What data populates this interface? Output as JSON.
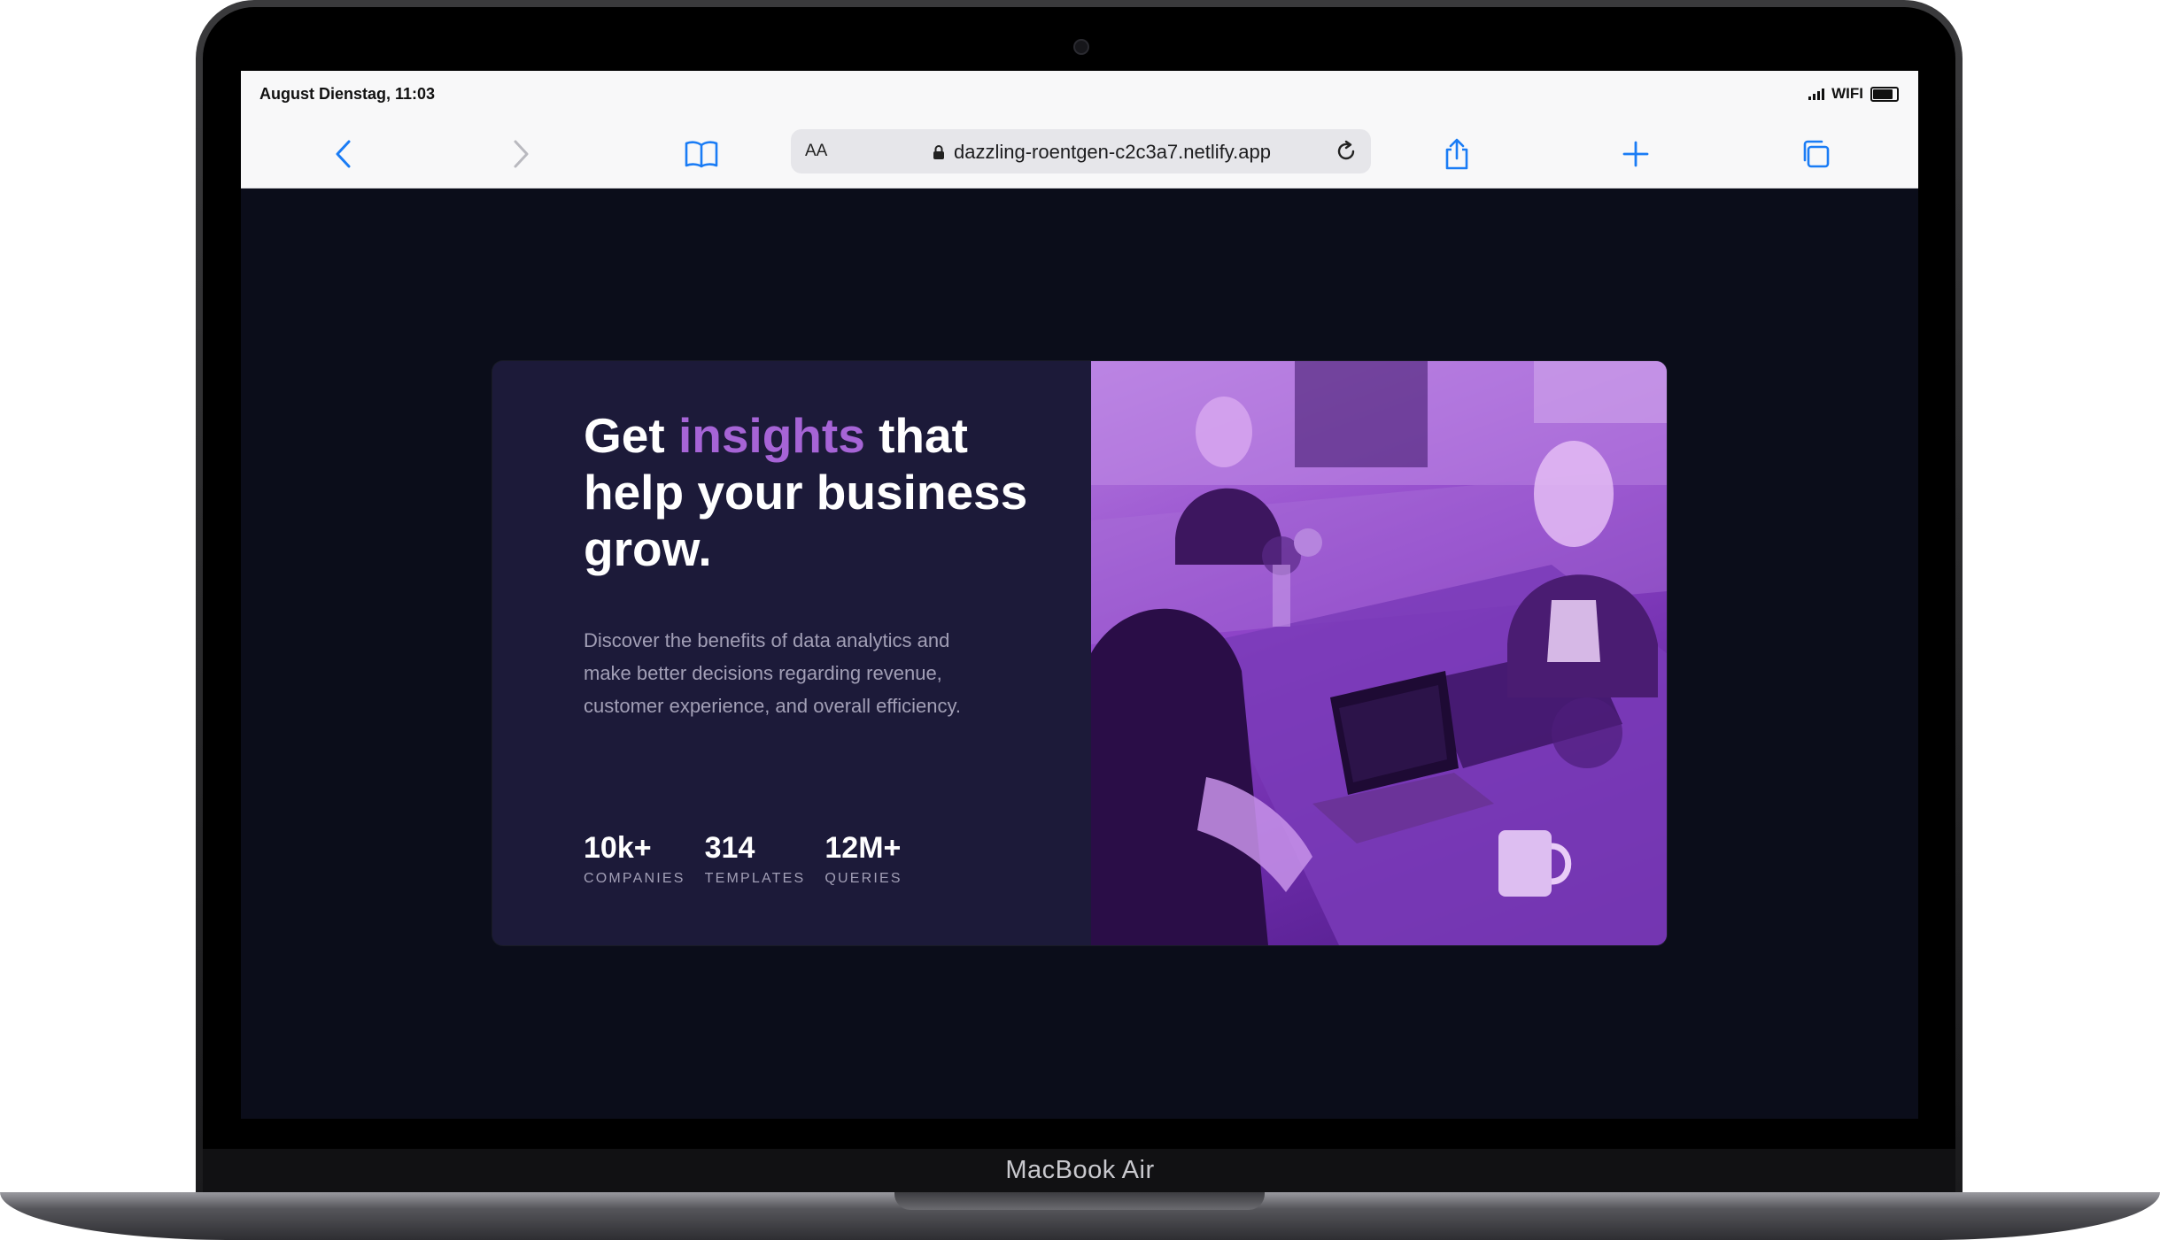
{
  "device": {
    "label": "MacBook Air"
  },
  "status_bar": {
    "time": "August Dienstag, 11:03",
    "wifi": "WIFI"
  },
  "browser": {
    "text_size_label": "AA",
    "url": "dazzling-roentgen-c2c3a7.netlify.app",
    "accent_color": "#1a7cf5"
  },
  "hero": {
    "headline_before": "Get",
    "headline_accent": "insights",
    "headline_after": "that help your business grow.",
    "accent_color": "#a664d6",
    "description": "Discover the benefits of data analytics and make better decisions regarding revenue, customer experience, and overall efficiency.",
    "stats": [
      {
        "value": "10k+",
        "label": "COMPANIES"
      },
      {
        "value": "314",
        "label": "TEMPLATES"
      },
      {
        "value": "12M+",
        "label": "QUERIES"
      }
    ],
    "image_tint": "#8f45c9"
  }
}
